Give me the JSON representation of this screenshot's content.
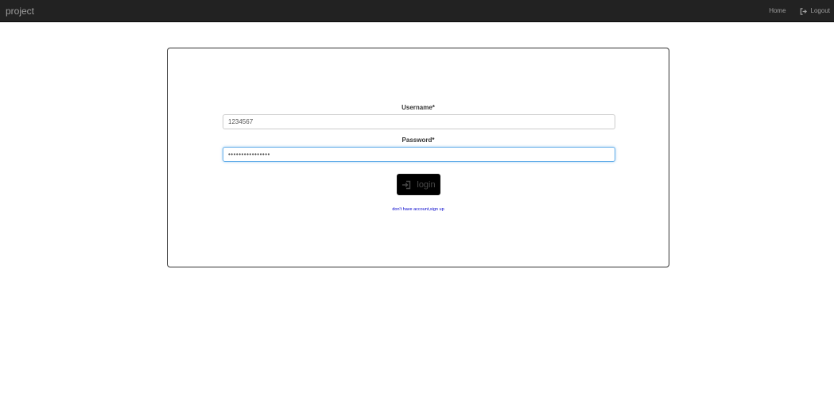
{
  "navbar": {
    "brand": "project",
    "links": [
      {
        "label": "Home"
      },
      {
        "label": "Logout",
        "icon": "logout-icon"
      }
    ]
  },
  "form": {
    "username_label": "Username*",
    "username_value": "1234567",
    "password_label": "Password*",
    "password_value": "••••••••••••••••",
    "login_label": "login",
    "login_icon": "login-icon",
    "signup_text": "don't have account,sign up"
  },
  "colors": {
    "navbar_bg": "#222222",
    "nav_text": "#9d9d9d",
    "button_bg": "#000000",
    "link": "#0000cc",
    "focus_border": "#66afe9"
  }
}
